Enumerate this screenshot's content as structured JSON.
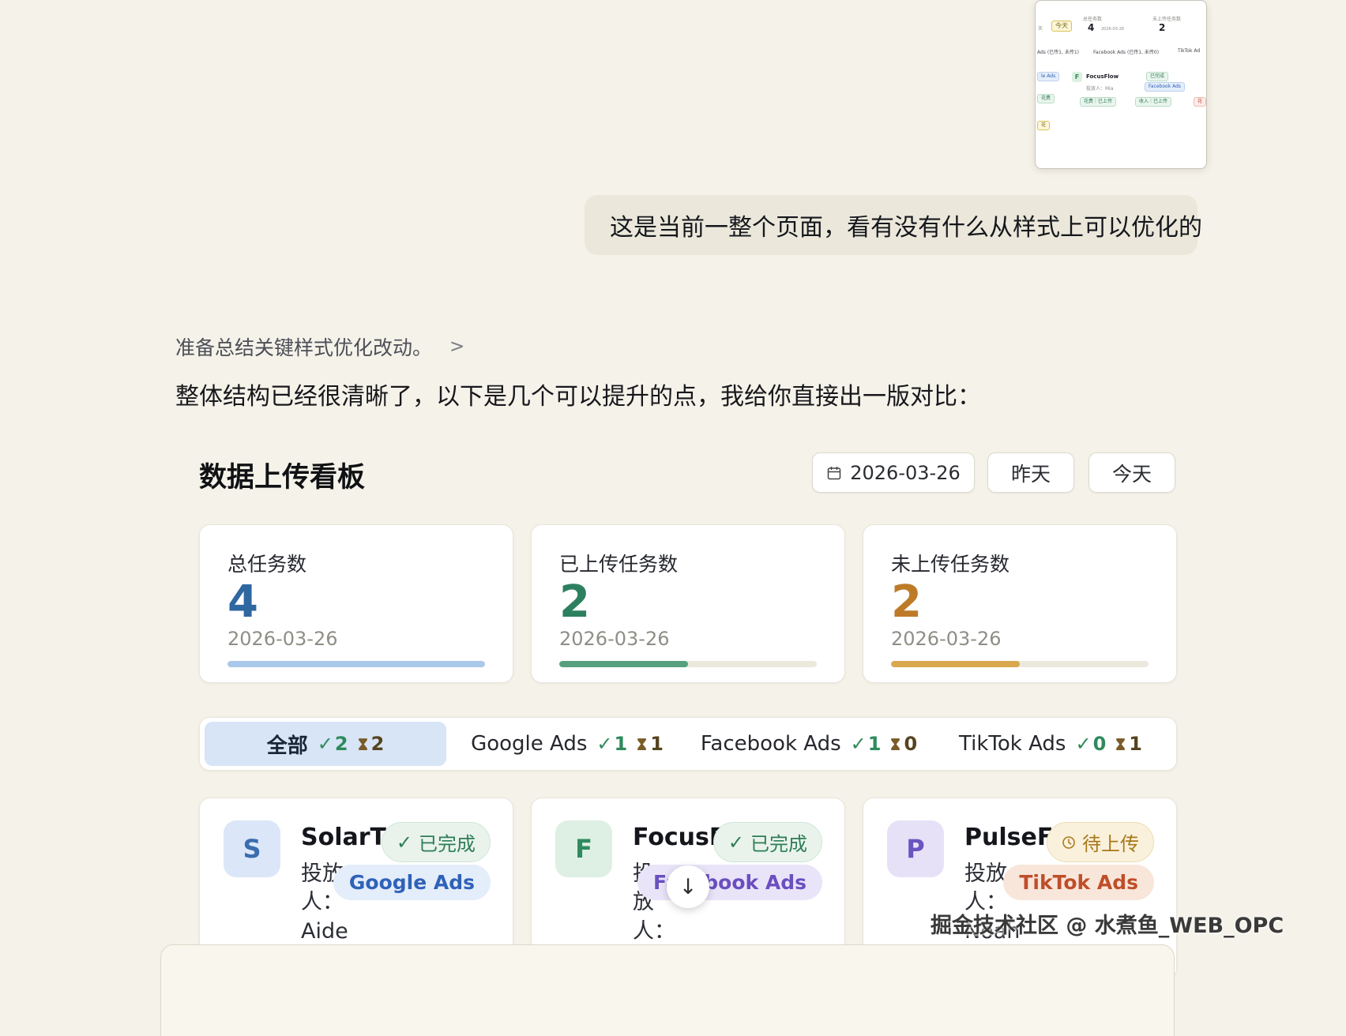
{
  "icons": {
    "check": "✓",
    "arrow_down": "↓",
    "chevron": ">"
  },
  "thumbnail": {
    "fragment_left": "天",
    "today_pill": "今天",
    "stat1_label": "总任务数",
    "stat1_value": "4",
    "stat1_date": "2026-03-26",
    "stat2_label": "未上传任务数",
    "stat2_value": "2",
    "tab1": "Ads (已传1, 未传1)",
    "tab2": "Facebook Ads (已传1, 未传0)",
    "tab3": "TikTok Ad",
    "side_pill_1": "le Ads",
    "side_pill_2": "花费",
    "side_pill_3": "花",
    "card": {
      "initial": "F",
      "name": "FocusFlow",
      "status": "已完成",
      "owner": "投放人：Mia",
      "platform": "Facebook Ads",
      "pill_spend": "花费｜已上传",
      "pill_income": "收入｜已上传",
      "pill_right": "花"
    }
  },
  "chat": {
    "user_message": "这是当前一整个页面，看有没有什么从样式上可以优化的",
    "thinking_text": "准备总结关键样式优化改动。",
    "assistant_text": "整体结构已经很清晰了，以下是几个可以提升的点，我给你直接出一版对比："
  },
  "dashboard": {
    "title": "数据上传看板",
    "date_value": "2026-03-26",
    "yesterday_label": "昨天",
    "today_label": "今天",
    "stats": [
      {
        "label": "总任务数",
        "value": "4",
        "date": "2026-03-26",
        "value_color": "#2f67a0",
        "bar_color": "#aac8ea",
        "progress": 100
      },
      {
        "label": "已上传任务数",
        "value": "2",
        "date": "2026-03-26",
        "value_color": "#2c8060",
        "bar_color": "#57a07f",
        "progress": 50
      },
      {
        "label": "未上传任务数",
        "value": "2",
        "date": "2026-03-26",
        "value_color": "#bd7b28",
        "bar_color": "#d9a84e",
        "progress": 50
      }
    ],
    "tabs": [
      {
        "label": "全部",
        "done": "2",
        "pending": "2"
      },
      {
        "label": "Google Ads",
        "done": "1",
        "pending": "1"
      },
      {
        "label": "Facebook Ads",
        "done": "1",
        "pending": "0"
      },
      {
        "label": "TikTok Ads",
        "done": "0",
        "pending": "1"
      }
    ],
    "cards": [
      {
        "initial": "S",
        "name": "SolarTrack",
        "status": "已完成",
        "owner": "投放人：Aiden",
        "platform": "Google Ads",
        "avatar_bg": "#dbe7f8",
        "avatar_color": "#3a6db0",
        "tag_bg": "#e4edfa",
        "tag_color": "#2f62b8"
      },
      {
        "initial": "F",
        "name": "FocusFlow",
        "status": "已完成",
        "owner": "投放人：Mia",
        "platform": "Facebook Ads",
        "avatar_bg": "#def0e3",
        "avatar_color": "#2f8a5d",
        "tag_bg": "#eae4f9",
        "tag_color": "#6a4fc0"
      },
      {
        "initial": "P",
        "name": "PulseFit",
        "status": "待上传",
        "owner": "投放人：Noah",
        "platform": "TikTok Ads",
        "avatar_bg": "#e7e1f8",
        "avatar_color": "#6a55c0",
        "tag_bg": "#f8e6da",
        "tag_color": "#bf4e2a"
      }
    ]
  },
  "watermark": "掘金技术社区 @ 水煮鱼_WEB_OPC"
}
